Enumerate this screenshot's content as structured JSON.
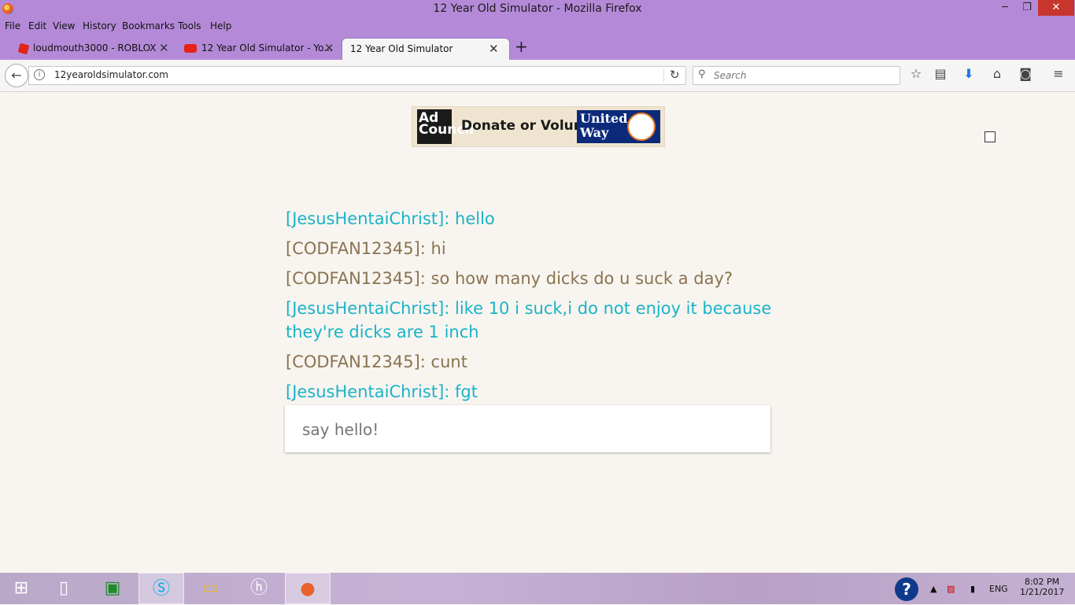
{
  "window": {
    "title": "12 Year Old Simulator - Mozilla Firefox",
    "minimize": "─",
    "maximize": "❐",
    "close": "✕"
  },
  "menu": [
    "File",
    "Edit",
    "View",
    "History",
    "Bookmarks",
    "Tools",
    "Help"
  ],
  "tabs": [
    {
      "label": "loudmouth3000 - ROBLOX",
      "favicon_color": "#e2231a"
    },
    {
      "label": "12 Year Old Simulator - Yo...",
      "favicon_color": "#e62117"
    },
    {
      "label": "12 Year Old Simulator",
      "favicon_color": ""
    }
  ],
  "nav": {
    "url": "12yearoldsimulator.com",
    "search_placeholder": "Search"
  },
  "ad": {
    "left_logo": "Ad Council",
    "text": "Donate or Volunteer",
    "right_logo": "United Way"
  },
  "chat": {
    "messages": [
      {
        "text": "[JesusHentaiChrist]: hello",
        "color": "#1ab3c8"
      },
      {
        "text": "[CODFAN12345]: hi",
        "color": "#8a7350"
      },
      {
        "text": "[CODFAN12345]: so how many dicks do u suck a day?",
        "color": "#8a7350"
      },
      {
        "text": "[JesusHentaiChrist]: like 10 i suck,i do not enjoy it because they're dicks are 1 inch",
        "color": "#1ab3c8"
      },
      {
        "text": "[CODFAN12345]: cunt",
        "color": "#8a7350"
      },
      {
        "text": "[JesusHentaiChrist]: fgt",
        "color": "#1ab3c8"
      }
    ],
    "input_placeholder": "say hello!"
  },
  "taskbar": {
    "tray": {
      "language": "ENG",
      "time": "8:02 PM",
      "date": "1/21/2017"
    }
  }
}
